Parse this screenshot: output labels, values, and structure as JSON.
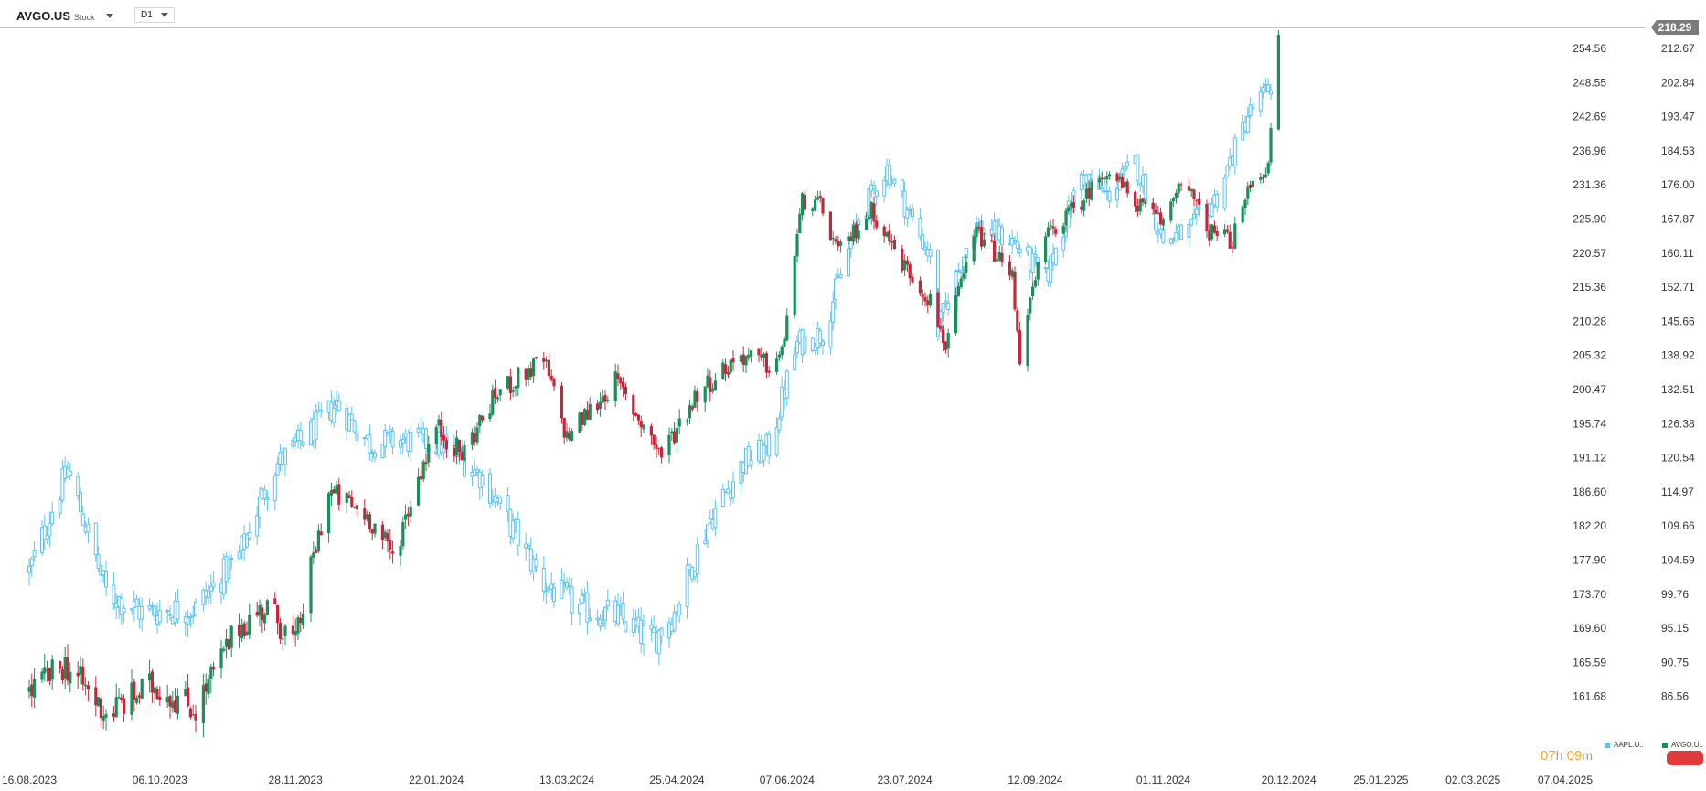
{
  "header": {
    "symbol": "AVGO.US",
    "symbol_type": "Stock",
    "timeframe": "D1"
  },
  "colors": {
    "bull": "#1a8f5a",
    "bear": "#c9253a",
    "aapl": "#5bc3f0",
    "price_line": "#888888",
    "price_tag": "#7b7b7b"
  },
  "chart_data": {
    "type": "line",
    "title": "",
    "x_axis": {
      "ticks": [
        "16.08.2023",
        "06.10.2023",
        "28.11.2023",
        "22.01.2024",
        "13.03.2024",
        "25.04.2024",
        "07.06.2024",
        "23.07.2024",
        "12.09.2024",
        "01.11.2024",
        "20.12.2024",
        "25.01.2025",
        "02.03.2025",
        "07.04.2025"
      ]
    },
    "left_axis": {
      "ticks": [
        "254.56",
        "248.55",
        "242.69",
        "236.96",
        "231.36",
        "225.90",
        "220.57",
        "215.36",
        "210.28",
        "205.32",
        "200.47",
        "195.74",
        "191.12",
        "186.60",
        "182.20",
        "177.90",
        "173.70",
        "169.60",
        "165.59",
        "161.68"
      ]
    },
    "right_axis": {
      "ticks": [
        "212.67",
        "202.84",
        "193.47",
        "184.53",
        "176.00",
        "167.87",
        "160.11",
        "152.71",
        "145.66",
        "138.92",
        "132.51",
        "126.38",
        "120.54",
        "114.97",
        "109.66",
        "104.59",
        "99.76",
        "95.15",
        "90.75",
        "86.56"
      ],
      "range": [
        86.56,
        218.29
      ]
    },
    "current_price": "218.29",
    "series": [
      {
        "name": "AAPL.U..",
        "style": "candlestick-outline",
        "anchors": [
          [
            "16.08.2023",
            176.5
          ],
          [
            "31.08.2023",
            189.5
          ],
          [
            "15.09.2023",
            174.0
          ],
          [
            "29.09.2023",
            171.5
          ],
          [
            "20.10.2023",
            172.0
          ],
          [
            "06.11.2023",
            178.5
          ],
          [
            "20.11.2023",
            190.0
          ],
          [
            "05.12.2023",
            195.0
          ],
          [
            "14.12.2023",
            198.5
          ],
          [
            "27.12.2023",
            193.0
          ],
          [
            "08.01.2024",
            193.5
          ],
          [
            "25.01.2024",
            193.0
          ],
          [
            "09.02.2024",
            188.5
          ],
          [
            "04.03.2024",
            175.0
          ],
          [
            "18.03.2024",
            172.0
          ],
          [
            "02.04.2024",
            171.0
          ],
          [
            "15.04.2024",
            168.0
          ],
          [
            "24.04.2024",
            171.5
          ],
          [
            "07.05.2024",
            182.5
          ],
          [
            "21.05.2024",
            190.5
          ],
          [
            "31.05.2024",
            192.5
          ],
          [
            "11.06.2024",
            207.0
          ],
          [
            "21.06.2024",
            208.5
          ],
          [
            "05.07.2024",
            226.0
          ],
          [
            "16.07.2024",
            234.0
          ],
          [
            "02.08.2024",
            220.0
          ],
          [
            "05.08.2024",
            209.0
          ],
          [
            "19.08.2024",
            225.0
          ],
          [
            "03.09.2024",
            222.5
          ],
          [
            "16.09.2024",
            216.5
          ],
          [
            "30.09.2024",
            233.0
          ],
          [
            "10.10.2024",
            229.5
          ],
          [
            "21.10.2024",
            235.0
          ],
          [
            "01.11.2024",
            222.5
          ],
          [
            "11.11.2024",
            224.0
          ],
          [
            "22.11.2024",
            229.5
          ],
          [
            "04.12.2024",
            243.0
          ],
          [
            "13.12.2024",
            248.0
          ]
        ]
      },
      {
        "name": "AVGO.U..",
        "style": "candlestick",
        "anchors": [
          [
            "16.08.2023",
            87.0
          ],
          [
            "30.08.2023",
            90.5
          ],
          [
            "15.09.2023",
            84.5
          ],
          [
            "04.10.2023",
            88.0
          ],
          [
            "20.10.2023",
            85.0
          ],
          [
            "06.11.2023",
            95.5
          ],
          [
            "17.11.2023",
            98.0
          ],
          [
            "28.11.2023",
            93.0
          ],
          [
            "11.12.2023",
            115.0
          ],
          [
            "27.12.2023",
            111.0
          ],
          [
            "05.01.2024",
            105.0
          ],
          [
            "22.01.2024",
            126.0
          ],
          [
            "01.02.2024",
            121.0
          ],
          [
            "15.02.2024",
            132.0
          ],
          [
            "04.03.2024",
            138.0
          ],
          [
            "13.03.2024",
            124.0
          ],
          [
            "01.04.2024",
            134.0
          ],
          [
            "19.04.2024",
            121.0
          ],
          [
            "03.05.2024",
            132.0
          ],
          [
            "20.05.2024",
            139.0
          ],
          [
            "31.05.2024",
            137.0
          ],
          [
            "05.06.2024",
            139.0
          ],
          [
            "13.06.2024",
            172.0
          ],
          [
            "20.06.2024",
            171.0
          ],
          [
            "27.06.2024",
            160.0
          ],
          [
            "10.07.2024",
            170.0
          ],
          [
            "22.07.2024",
            158.0
          ],
          [
            "02.08.2024",
            150.0
          ],
          [
            "08.08.2024",
            141.0
          ],
          [
            "20.08.2024",
            165.0
          ],
          [
            "03.09.2024",
            155.0
          ],
          [
            "06.09.2024",
            139.0
          ],
          [
            "16.09.2024",
            164.0
          ],
          [
            "30.09.2024",
            172.0
          ],
          [
            "10.10.2024",
            180.0
          ],
          [
            "21.10.2024",
            172.0
          ],
          [
            "01.11.2024",
            167.0
          ],
          [
            "08.11.2024",
            178.0
          ],
          [
            "19.11.2024",
            165.0
          ],
          [
            "28.11.2024",
            163.0
          ],
          [
            "06.12.2024",
            178.0
          ],
          [
            "12.12.2024",
            180.0
          ],
          [
            "16.12.2024",
            216.0
          ]
        ]
      }
    ]
  }
}
